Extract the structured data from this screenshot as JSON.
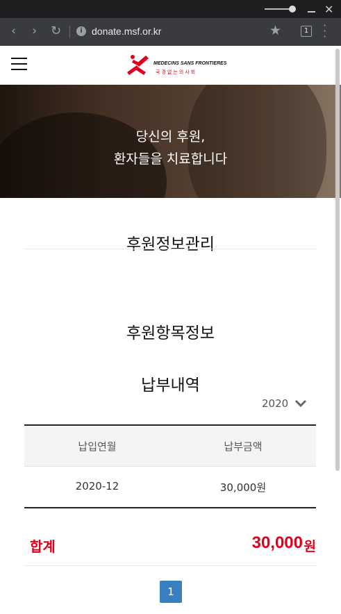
{
  "browser": {
    "url": "donate.msf.or.kr",
    "tab_count": "1"
  },
  "logo": {
    "text_en": "MEDECINS SANS FRONTIERES",
    "text_ko": "국경없는의사회"
  },
  "hero": {
    "line1": "당신의 후원,",
    "line2": "환자들을 치료합니다"
  },
  "sections": {
    "management": "후원정보관리",
    "item_info": "후원항목정보",
    "payment_history": "납부내역"
  },
  "year_select": {
    "value": "2020"
  },
  "table": {
    "headers": [
      "납입연월",
      "납부금액"
    ],
    "rows": [
      [
        "2020-12",
        "30,000원"
      ]
    ]
  },
  "total": {
    "label": "합계",
    "amount": "30,000",
    "unit": "원"
  },
  "pagination": {
    "current": "1"
  },
  "colors": {
    "accent_red": "#e0001b",
    "pagination_blue": "#3a7fc1"
  }
}
